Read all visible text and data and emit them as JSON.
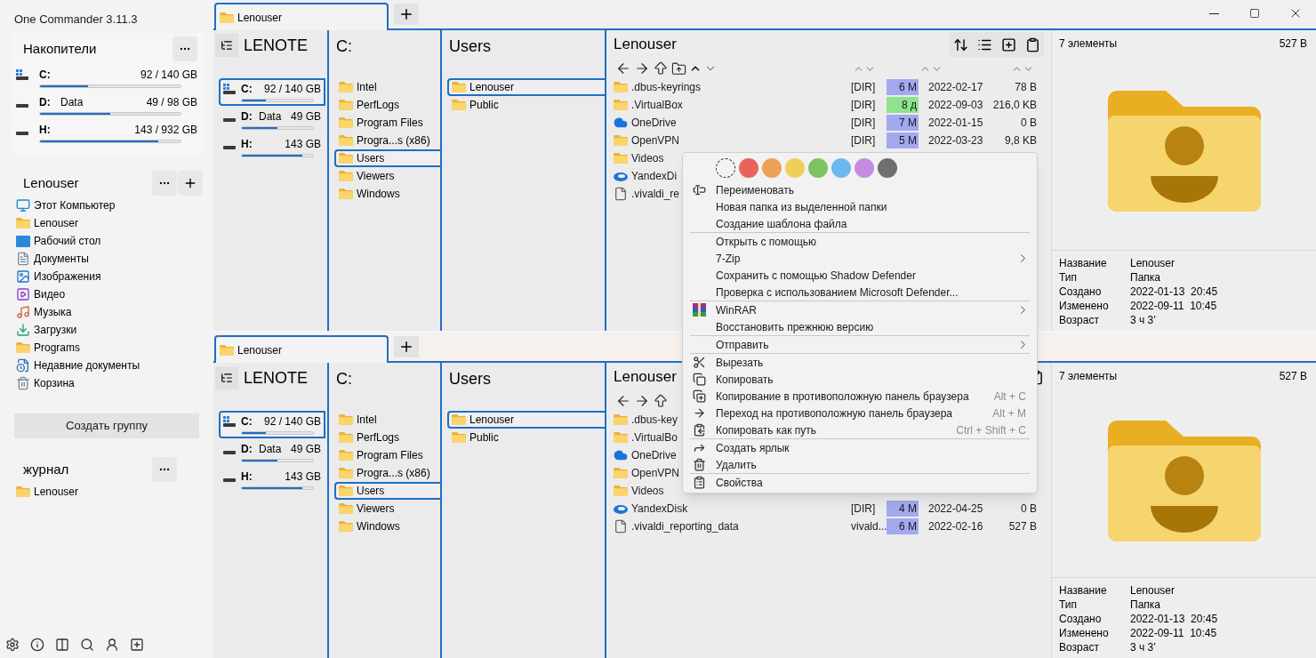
{
  "app_title": "One Commander 3.11.3",
  "sidebar": {
    "drives_section": {
      "title": "Накопители",
      "drives": [
        {
          "letter": "C:",
          "usage": "92 / 140 GB",
          "level": 0.34,
          "system": true
        },
        {
          "letter": "D:",
          "label": "Data",
          "usage": "49 / 98 GB",
          "level": 0.5,
          "system": false
        },
        {
          "letter": "H:",
          "usage": "143 / 932 GB",
          "level": 0.84,
          "system": false
        }
      ]
    },
    "group": {
      "title": "Lenouser",
      "items": [
        {
          "label": "Этот Компьютер",
          "kind": "computer"
        },
        {
          "label": "Lenouser",
          "kind": "folder"
        },
        {
          "label": "Рабочий стол",
          "kind": "desktop"
        },
        {
          "label": "Документы",
          "kind": "documents"
        },
        {
          "label": "Изображения",
          "kind": "pictures"
        },
        {
          "label": "Видео",
          "kind": "video"
        },
        {
          "label": "Музыка",
          "kind": "music"
        },
        {
          "label": "Загрузки",
          "kind": "downloads"
        },
        {
          "label": "Programs",
          "kind": "folder"
        },
        {
          "label": "Недавние документы",
          "kind": "recent"
        },
        {
          "label": "Корзина",
          "kind": "trash"
        }
      ]
    },
    "create_group_button": "Создать группу",
    "journal": {
      "title": "журнал",
      "items": [
        {
          "label": "Lenouser",
          "kind": "folder"
        }
      ]
    }
  },
  "panes": [
    {
      "tab": {
        "label": "Lenouser",
        "selected": true
      },
      "drives_column": {
        "title": "LENOTE",
        "drives": [
          {
            "letter": "C:",
            "usage": "92 / 140 GB",
            "level": 0.34,
            "system": true,
            "selected": true
          },
          {
            "letter": "D:",
            "label": "Data",
            "usage": "49 GB",
            "level": 0.5,
            "system": false,
            "selected": false
          },
          {
            "letter": "H:",
            "usage": "143 GB",
            "level": 0.85,
            "system": false,
            "selected": false
          }
        ]
      },
      "columns": [
        {
          "title": "C:",
          "items": [
            {
              "label": "Intel",
              "selected": false
            },
            {
              "label": "PerfLogs",
              "selected": false
            },
            {
              "label": "Program Files",
              "selected": false
            },
            {
              "label": "Progra...s (x86)",
              "selected": false
            },
            {
              "label": "Users",
              "selected": true
            },
            {
              "label": "Viewers",
              "selected": false
            },
            {
              "label": "Windows",
              "selected": false
            }
          ]
        },
        {
          "title": "Users",
          "items": [
            {
              "label": "Lenouser",
              "selected": true
            },
            {
              "label": "Public",
              "selected": false
            }
          ]
        }
      ],
      "file_list": {
        "title": "Lenouser",
        "rows": [
          {
            "name": ".dbus-keyrings",
            "kind": "folder",
            "type": "[DIR]",
            "age": "6 M",
            "color": "#a3a9ee",
            "date": "2022-02-17",
            "size": "78 B"
          },
          {
            "name": ".VirtualBox",
            "kind": "folder",
            "type": "[DIR]",
            "age": "8 д",
            "color": "#8fe38f",
            "date": "2022-09-03",
            "size": "216,0 KB"
          },
          {
            "name": "OneDrive",
            "kind": "cloud",
            "type": "[DIR]",
            "age": "7 M",
            "color": "#a3a9ee",
            "date": "2022-01-15",
            "size": "0 B"
          },
          {
            "name": "OpenVPN",
            "kind": "folder",
            "type": "[DIR]",
            "age": "5 M",
            "color": "#a3a9ee",
            "date": "2022-03-23",
            "size": "9,8 KB"
          },
          {
            "name": "Videos",
            "kind": "folder"
          },
          {
            "name": "YandexDi",
            "kind": "disk"
          },
          {
            "name": ".vivaldi_re",
            "kind": "file"
          }
        ]
      },
      "preview": {
        "count": "7 элементы",
        "size": "527 B",
        "properties": [
          {
            "label": "Название",
            "value": "Lenouser"
          },
          {
            "label": "Тип",
            "value": "Папка"
          },
          {
            "label": "Создано",
            "value": "2022-01-13  20:45"
          },
          {
            "label": "Изменено",
            "value": "2022-09-11  10:45"
          },
          {
            "label": "Возраст",
            "value": "3 ч 3’"
          }
        ]
      }
    },
    {
      "tab": {
        "label": "Lenouser",
        "selected": true
      },
      "drives_column": {
        "title": "LENOTE",
        "drives": [
          {
            "letter": "C:",
            "usage": "92 / 140 GB",
            "level": 0.34,
            "system": true,
            "selected": true
          },
          {
            "letter": "D:",
            "label": "Data",
            "usage": "49 GB",
            "level": 0.5,
            "system": false,
            "selected": false
          },
          {
            "letter": "H:",
            "usage": "143 GB",
            "level": 0.85,
            "system": false,
            "selected": false
          }
        ]
      },
      "columns": [
        {
          "title": "C:",
          "items": [
            {
              "label": "Intel",
              "selected": false
            },
            {
              "label": "PerfLogs",
              "selected": false
            },
            {
              "label": "Program Files",
              "selected": false
            },
            {
              "label": "Progra...s (x86)",
              "selected": false
            },
            {
              "label": "Users",
              "selected": true
            },
            {
              "label": "Viewers",
              "selected": false
            },
            {
              "label": "Windows",
              "selected": false
            }
          ]
        },
        {
          "title": "Users",
          "items": [
            {
              "label": "Lenouser",
              "selected": true
            },
            {
              "label": "Public",
              "selected": false
            }
          ]
        }
      ],
      "file_list": {
        "title": "Lenouser",
        "rows": [
          {
            "name": ".dbus-key",
            "kind": "folder"
          },
          {
            "name": ".VirtualBo",
            "kind": "folder"
          },
          {
            "name": "OneDrive",
            "kind": "cloud"
          },
          {
            "name": "OpenVPN",
            "kind": "folder"
          },
          {
            "name": "Videos",
            "kind": "folder"
          },
          {
            "name": "YandexDisk",
            "kind": "disk",
            "type": "[DIR]",
            "age": "4 M",
            "color": "#a3a9ee",
            "date": "2022-04-25",
            "size": "0 B"
          },
          {
            "name": ".vivaldi_reporting_data",
            "kind": "file",
            "type": "vivald...",
            "age": "6 M",
            "color": "#a3a9ee",
            "date": "2022-02-16",
            "size": "527 B"
          }
        ]
      },
      "preview": {
        "count": "7 элементы",
        "size": "527 B",
        "properties": [
          {
            "label": "Название",
            "value": "Lenouser"
          },
          {
            "label": "Тип",
            "value": "Папка"
          },
          {
            "label": "Создано",
            "value": "2022-01-13  20:45"
          },
          {
            "label": "Изменено",
            "value": "2022-09-11  10:45"
          },
          {
            "label": "Возраст",
            "value": "3 ч 3’"
          }
        ]
      }
    }
  ],
  "context_menu": {
    "swatches": [
      {
        "kind": "none"
      },
      {
        "kind": "color",
        "color": "#e8645a"
      },
      {
        "kind": "color",
        "color": "#eda157"
      },
      {
        "kind": "color",
        "color": "#efcf5a"
      },
      {
        "kind": "color",
        "color": "#7cc460"
      },
      {
        "kind": "color",
        "color": "#6bb8f0"
      },
      {
        "kind": "color",
        "color": "#c58be0"
      },
      {
        "kind": "color",
        "color": "#6f6f6f"
      }
    ],
    "groups": [
      [
        {
          "label": "Переименовать",
          "kind": "rename",
          "submenu": false
        },
        {
          "label": "Новая папка из выделенной папки",
          "submenu": false
        },
        {
          "label": "Создание шаблона файла",
          "submenu": false
        }
      ],
      [
        {
          "label": "Открыть с помощью",
          "submenu": false
        },
        {
          "label": "7-Zip",
          "submenu": true
        },
        {
          "label": "Сохранить с помощью Shadow Defender",
          "submenu": false
        },
        {
          "label": "Проверка с использованием Microsoft Defender...",
          "submenu": false
        }
      ],
      [
        {
          "label": "WinRAR",
          "kind": "archive",
          "submenu": true
        },
        {
          "label": "Восстановить прежнюю версию",
          "submenu": false
        }
      ],
      [
        {
          "label": "Отправить",
          "submenu": true
        }
      ],
      [
        {
          "label": "Вырезать",
          "kind": "cut",
          "submenu": false
        },
        {
          "label": "Копировать",
          "kind": "copy",
          "submenu": false
        },
        {
          "label": "Копирование в противоположную панель браузера",
          "kind": "copy-to",
          "shortcut": "Alt + C",
          "submenu": false
        },
        {
          "label": "Переход на противоположную панель браузера",
          "kind": "go-to",
          "shortcut": "Alt + M",
          "submenu": false
        },
        {
          "label": "Копировать как путь",
          "kind": "copy-path",
          "shortcut": "Ctrl + Shift + C",
          "submenu": false
        }
      ],
      [
        {
          "label": "Создать ярлык",
          "kind": "shortcut",
          "submenu": false
        },
        {
          "label": "Удалить",
          "kind": "delete",
          "submenu": false
        }
      ],
      [
        {
          "label": "Свойства",
          "kind": "properties",
          "submenu": false
        }
      ]
    ]
  }
}
